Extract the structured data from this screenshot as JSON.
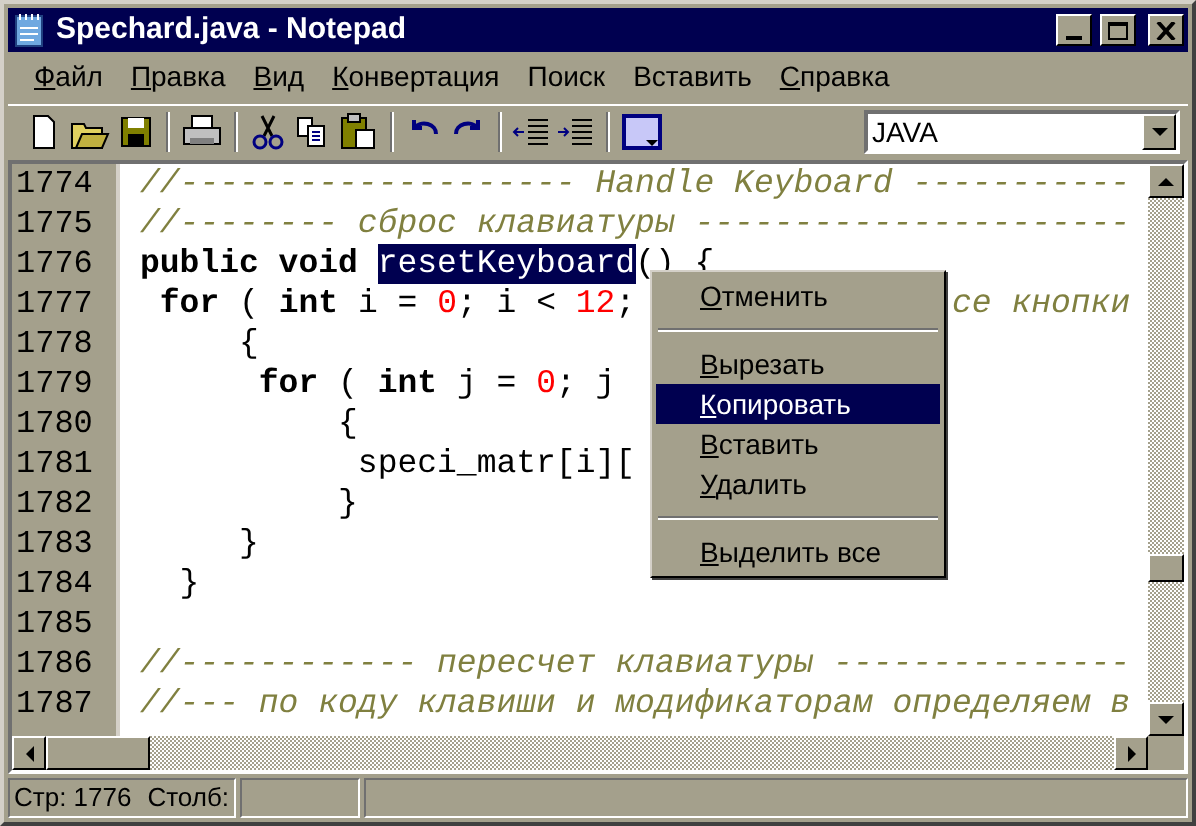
{
  "window": {
    "title": "Spechard.java - Notepad"
  },
  "menu": [
    {
      "label": "Файл",
      "mnemonic": true
    },
    {
      "label": "Правка",
      "mnemonic": true
    },
    {
      "label": "Вид",
      "mnemonic": true
    },
    {
      "label": "Конвертация",
      "mnemonic": true
    },
    {
      "label": "Поиск",
      "mnemonic": false
    },
    {
      "label": "Вставить",
      "mnemonic": false
    },
    {
      "label": "Справка",
      "mnemonic": true
    }
  ],
  "toolbar": {
    "language": "JAVA"
  },
  "editor": {
    "lines": [
      {
        "number": "1774",
        "tokens": [
          {
            "kind": "comment",
            "text": "//-------------------- Handle Keyboard -----------"
          }
        ]
      },
      {
        "number": "1775",
        "tokens": [
          {
            "kind": "comment",
            "text": "//-------- сброс клавиатуры ----------------------"
          }
        ]
      },
      {
        "number": "1776",
        "tokens": [
          {
            "kind": "keyword",
            "text": "public void "
          },
          {
            "kind": "selected",
            "text": "resetKeyboard"
          },
          {
            "kind": "plain",
            "text": "() {"
          }
        ]
      },
      {
        "number": "1777",
        "tokens": [
          {
            "kind": "keyword",
            "text": " for"
          },
          {
            "kind": "plain",
            "text": " ( "
          },
          {
            "kind": "keyword",
            "text": "int"
          },
          {
            "kind": "plain",
            "text": " i = "
          },
          {
            "kind": "number",
            "text": "0"
          },
          {
            "kind": "plain",
            "text": "; i < "
          },
          {
            "kind": "number",
            "text": "12"
          },
          {
            "kind": "plain",
            "text": ";"
          }
        ],
        "after_menu": "се кнопки"
      },
      {
        "number": "1778",
        "tokens": [
          {
            "kind": "plain",
            "text": "     {"
          }
        ]
      },
      {
        "number": "1779",
        "tokens": [
          {
            "kind": "keyword",
            "text": "      for"
          },
          {
            "kind": "plain",
            "text": " ( "
          },
          {
            "kind": "keyword",
            "text": "int"
          },
          {
            "kind": "plain",
            "text": " j = "
          },
          {
            "kind": "number",
            "text": "0"
          },
          {
            "kind": "plain",
            "text": "; j"
          }
        ]
      },
      {
        "number": "1780",
        "tokens": [
          {
            "kind": "plain",
            "text": "          {"
          }
        ]
      },
      {
        "number": "1781",
        "tokens": [
          {
            "kind": "plain",
            "text": "           speci_matr[i]["
          }
        ]
      },
      {
        "number": "1782",
        "tokens": [
          {
            "kind": "plain",
            "text": "          }"
          }
        ]
      },
      {
        "number": "1783",
        "tokens": [
          {
            "kind": "plain",
            "text": "     }"
          }
        ]
      },
      {
        "number": "1784",
        "tokens": [
          {
            "kind": "plain",
            "text": "  }"
          }
        ]
      },
      {
        "number": "1785"
      },
      {
        "number": "1786",
        "tokens": [
          {
            "kind": "comment",
            "text": "//------------ пересчет клавиатуры ---------------"
          }
        ]
      },
      {
        "number": "1787",
        "tokens": [
          {
            "kind": "comment",
            "text": "//--- по коду клавиши и модификаторам определяем в"
          }
        ]
      }
    ]
  },
  "context_menu": [
    {
      "kind": "item",
      "label": "Отменить",
      "selected": false
    },
    {
      "kind": "separator"
    },
    {
      "kind": "item",
      "label": "Вырезать",
      "selected": false
    },
    {
      "kind": "item",
      "label": "Копировать",
      "selected": true
    },
    {
      "kind": "item",
      "label": "Вставить",
      "selected": false
    },
    {
      "kind": "item",
      "label": "Удалить",
      "selected": false
    },
    {
      "kind": "separator"
    },
    {
      "kind": "item",
      "label": "Выделить все",
      "selected": false
    }
  ],
  "status_bar": {
    "line": "Стр: 1776",
    "column": "Столб:"
  }
}
